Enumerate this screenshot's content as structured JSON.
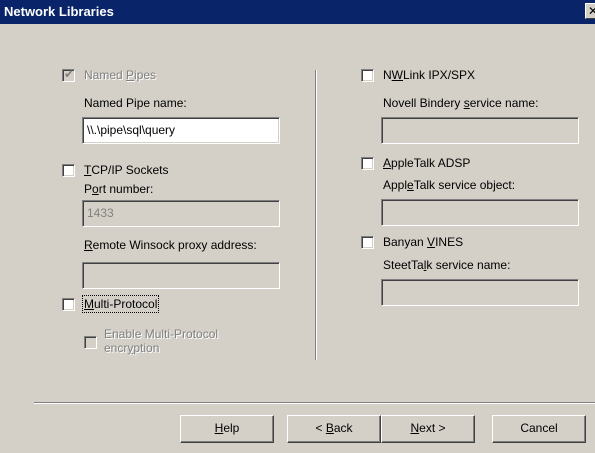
{
  "window": {
    "title": "Network Libraries",
    "close_glyph": "✕"
  },
  "left": {
    "named_pipes": {
      "checkbox_label": "Named Pipes",
      "checked": true,
      "field_label": "Named Pipe name:",
      "field_value": "\\\\.\\pipe\\sql\\query"
    },
    "tcpip": {
      "checkbox_label": "TCP/IP Sockets",
      "port_label": "Port number:",
      "port_value": "1433",
      "proxy_label": "Remote Winsock proxy address:",
      "proxy_value": ""
    },
    "multiprotocol": {
      "checkbox_label": "Multi-Protocol",
      "encryption_label_line1": "Enable Multi-Protocol",
      "encryption_label_line2": "encryption"
    }
  },
  "right": {
    "nwlink": {
      "checkbox_label": "NWLink IPX/SPX",
      "field_label": "Novell Bindery service name:",
      "field_value": ""
    },
    "appletalk": {
      "checkbox_label": "AppleTalk ADSP",
      "field_label": "AppleTalk service object:",
      "field_value": ""
    },
    "banyan": {
      "checkbox_label": "Banyan VINES",
      "field_label": "SteetTalk service name:",
      "field_value": ""
    }
  },
  "buttons": {
    "help": "Help",
    "back": "< Back",
    "next": "Next >",
    "cancel": "Cancel"
  }
}
